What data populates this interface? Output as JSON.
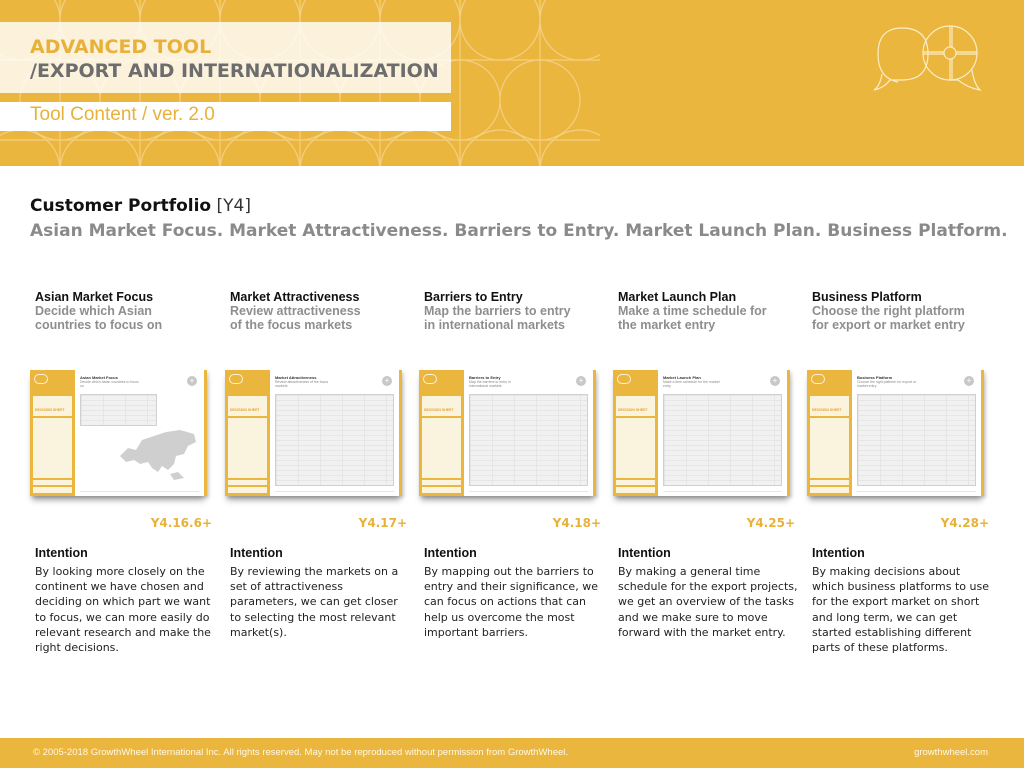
{
  "header": {
    "title_line1": "ADVANCED TOOL",
    "title_line2": "/EXPORT AND INTERNATIONALIZATION",
    "subtitle": "Tool Content / ver. 2.0",
    "logo": "growthwheel-speech-bubbles-logo-icon",
    "colors": {
      "brand": "#ebb63e",
      "title_accent": "#e8b13a",
      "title_gray": "#6d6d6d"
    }
  },
  "section": {
    "title": "Customer Portfolio",
    "code": "[Y4]",
    "subtitle": "Asian Market Focus. Market Attractiveness. Barriers to Entry. Market Launch Plan. Business Platform."
  },
  "tools": [
    {
      "name": "Asian Market Focus",
      "desc_line1": "Decide which Asian",
      "desc_line2": "countries to focus on",
      "thumb_title": "Asian Market Focus",
      "thumb_sub": "Decide which Asian countries to focus on",
      "ref": "Y4.16.6+",
      "intention_label": "Intention",
      "intention_text": "By looking more closely on the continent we have chosen and deciding on which part we want to focus, we can more easily do relevant research and make the right decisions."
    },
    {
      "name": "Market Attractiveness",
      "desc_line1": "Review attractiveness",
      "desc_line2": "of the focus markets",
      "thumb_title": "Market Attractiveness",
      "thumb_sub": "Review attractiveness of the focus markets",
      "ref": "Y4.17+",
      "intention_label": "Intention",
      "intention_text": "By reviewing the markets on a set of attractiveness parameters, we can get closer to selecting the most relevant market(s)."
    },
    {
      "name": "Barriers to Entry",
      "desc_line1": "Map the barriers to entry",
      "desc_line2": "in international markets",
      "thumb_title": "Barriers to Entry",
      "thumb_sub": "Map the barriers to entry in international markets",
      "ref": "Y4.18+",
      "intention_label": "Intention",
      "intention_text": "By mapping out the barriers to entry and their significance, we can focus on actions that can help us overcome the most important barriers."
    },
    {
      "name": "Market Launch Plan",
      "desc_line1": "Make a time schedule for",
      "desc_line2": "the market entry",
      "thumb_title": "Market Launch Plan",
      "thumb_sub": "Make a time schedule for the market entry",
      "ref": "Y4.25+",
      "intention_label": "Intention",
      "intention_text": "By making a general time schedule for the export projects, we get an overview of the tasks and we make sure to move forward with the market entry."
    },
    {
      "name": "Business Platform",
      "desc_line1": "Choose the right platform",
      "desc_line2": "for export or market entry",
      "thumb_title": "Business Platform",
      "thumb_sub": "Choose the right platform for export or market entry",
      "ref": "Y4.28+",
      "intention_label": "Intention",
      "intention_text": "By making decisions about which business platforms to use for the export market on short and long term, we can get started establishing different parts of these platforms."
    }
  ],
  "thumb_common": {
    "decision_sheet": "DECISION SHEET",
    "plus_glyph": "+"
  },
  "footer": {
    "copyright": "© 2005-2018 GrowthWheel International Inc. All rights reserved. May not be reproduced without permission from GrowthWheel.",
    "site": "growthwheel.com"
  }
}
